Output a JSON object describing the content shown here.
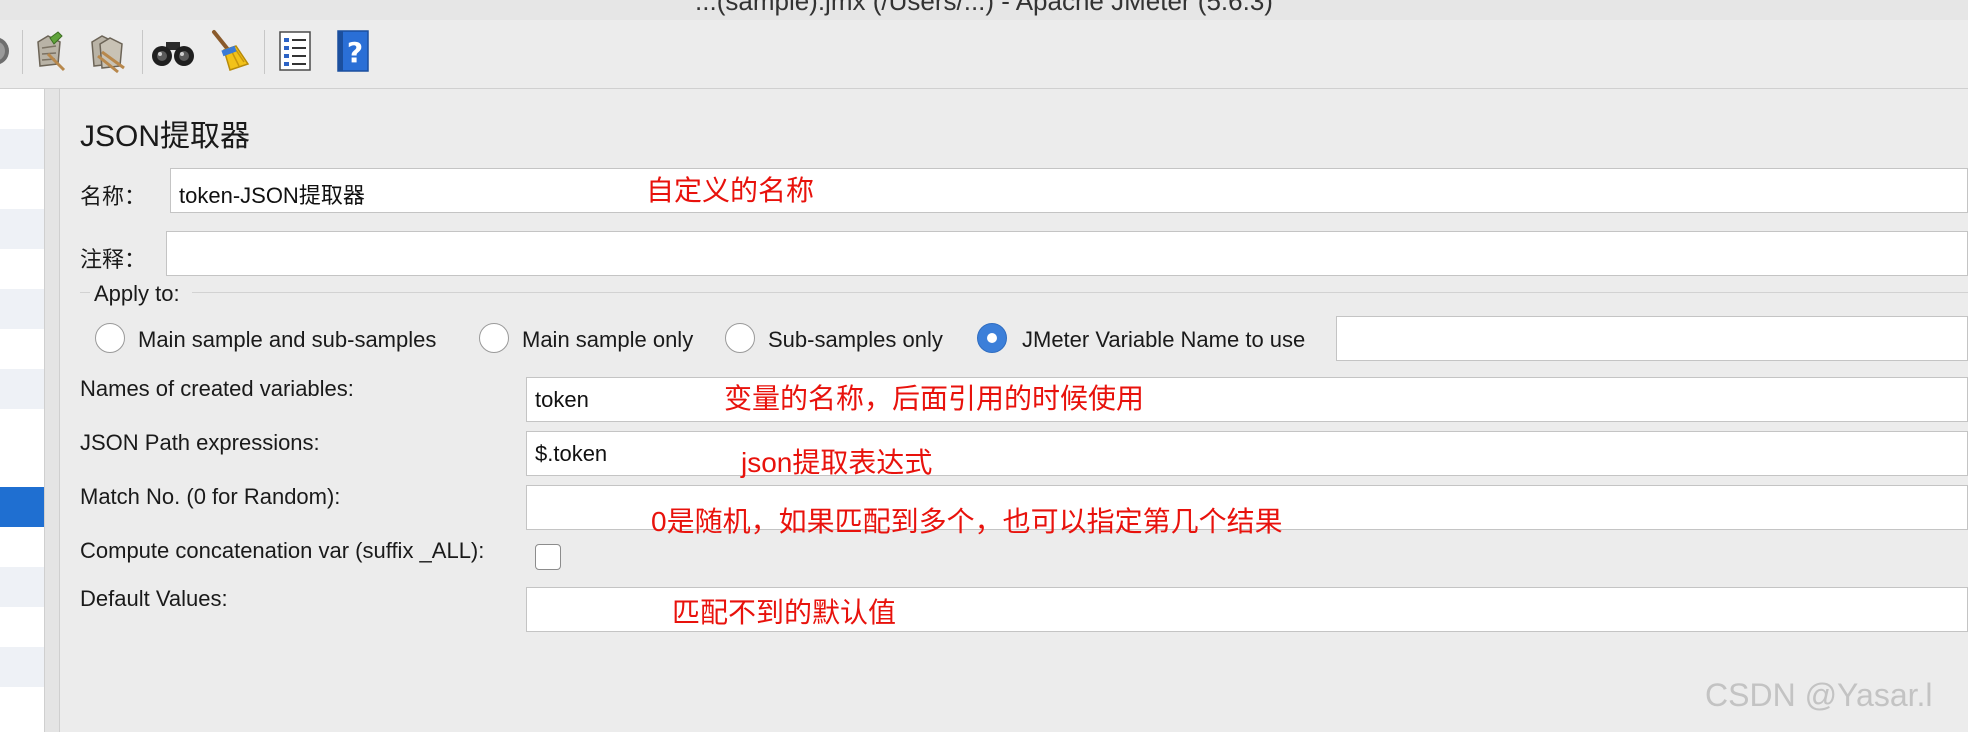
{
  "window": {
    "title": "...(sample).jmx (/Users/...) - Apache JMeter (5.6.3)"
  },
  "toolbar": {
    "items": [
      {
        "name": "stop-icon"
      },
      {
        "name": "clear-icon"
      },
      {
        "name": "clear-all-icon"
      },
      {
        "name": "search-binoculars-icon"
      },
      {
        "name": "reset-search-broom-icon"
      },
      {
        "name": "function-helper-list-icon"
      },
      {
        "name": "help-book-icon"
      }
    ]
  },
  "panel": {
    "title": "JSON提取器",
    "name_label": "名称：",
    "name_value": "token-JSON提取器",
    "comment_label": "注释：",
    "comment_value": "",
    "apply_to": {
      "legend": "Apply to:",
      "options": [
        {
          "label": "Main sample and sub-samples",
          "selected": false
        },
        {
          "label": "Main sample only",
          "selected": false
        },
        {
          "label": "Sub-samples only",
          "selected": false
        },
        {
          "label": "JMeter Variable Name to use",
          "selected": true
        }
      ],
      "variable_name_value": ""
    },
    "fields": {
      "names_label": "Names of created variables:",
      "names_value": "token",
      "path_label": "JSON Path expressions:",
      "path_value": "$.token",
      "match_label": "Match No. (0 for Random):",
      "match_value": "",
      "concat_label": "Compute concatenation var (suffix _ALL):",
      "concat_checked": false,
      "default_label": "Default Values:",
      "default_value": ""
    }
  },
  "annotations": {
    "name": "自定义的名称",
    "variables": "变量的名称，后面引用的时候使用",
    "path": "json提取表达式",
    "match": "0是随机，如果匹配到多个，也可以指定第几个结果",
    "default": "匹配不到的默认值"
  },
  "watermark": "CSDN @Yasar.l",
  "colors": {
    "annotation": "#e8120c",
    "selection": "#1f6fd1",
    "radio_selected": "#3c7fd9"
  }
}
